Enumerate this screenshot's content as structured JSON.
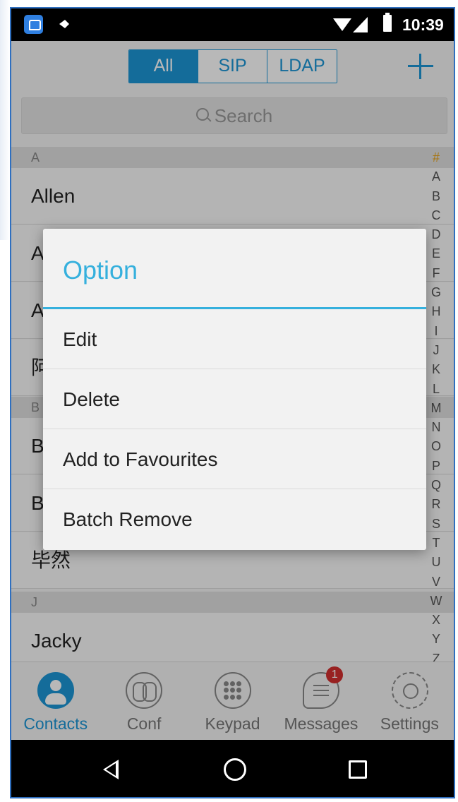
{
  "status_bar": {
    "time": "10:39",
    "icons": [
      "app-icon",
      "notification-icon",
      "wifi-icon",
      "signal-icon",
      "battery-icon"
    ]
  },
  "header": {
    "tabs": [
      {
        "label": "All",
        "active": true
      },
      {
        "label": "SIP",
        "active": false
      },
      {
        "label": "LDAP",
        "active": false
      }
    ],
    "add_icon": "plus-icon"
  },
  "search": {
    "placeholder": "Search"
  },
  "contacts": {
    "sections": [
      {
        "letter": "A",
        "items": [
          "Allen",
          "A",
          "A",
          "阿"
        ]
      },
      {
        "letter": "B",
        "items": [
          "B",
          "B",
          "毕然"
        ]
      },
      {
        "letter": "J",
        "items": [
          "Jacky"
        ]
      }
    ]
  },
  "index_bar": [
    "#",
    "A",
    "B",
    "C",
    "D",
    "E",
    "F",
    "G",
    "H",
    "I",
    "J",
    "K",
    "L",
    "M",
    "N",
    "O",
    "P",
    "Q",
    "R",
    "S",
    "T",
    "U",
    "V",
    "W",
    "X",
    "Y",
    "Z"
  ],
  "bottom_nav": [
    {
      "label": "Contacts",
      "active": true
    },
    {
      "label": "Conf",
      "active": false
    },
    {
      "label": "Keypad",
      "active": false
    },
    {
      "label": "Messages",
      "active": false,
      "badge": "1"
    },
    {
      "label": "Settings",
      "active": false
    }
  ],
  "dialog": {
    "title": "Option",
    "items": [
      "Edit",
      "Delete",
      "Add to Favourites",
      "Batch Remove"
    ]
  },
  "colors": {
    "accent": "#1d96d6",
    "dialog_accent": "#35b0dd",
    "badge": "#d32f2f",
    "index_hash": "#e8a317"
  }
}
